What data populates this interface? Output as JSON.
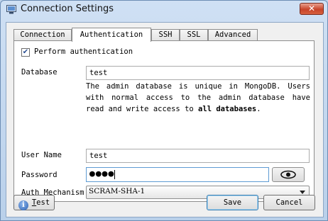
{
  "window": {
    "title": "Connection Settings",
    "close": "✕"
  },
  "tabs": [
    {
      "label": "Connection"
    },
    {
      "label": "Authentication"
    },
    {
      "label": "SSH"
    },
    {
      "label": "SSL"
    },
    {
      "label": "Advanced"
    }
  ],
  "active_tab": "Authentication",
  "auth": {
    "perform_label": "Perform authentication",
    "perform_checked": true,
    "database_label": "Database",
    "database_value": "test",
    "note_prefix": "The admin database is unique in MongoDB. Users with normal access to the admin database have read and write access to ",
    "note_bold": "all databases",
    "note_suffix": ".",
    "username_label": "User Name",
    "username_value": "test",
    "password_label": "Password",
    "password_masked": "●●●●",
    "mechanism_label": "Auth Mechanism",
    "mechanism_value": "SCRAM-SHA-1"
  },
  "buttons": {
    "test_prefix": "",
    "test_underline": "T",
    "test_rest": "est",
    "save": "Save",
    "cancel": "Cancel"
  },
  "icons": {
    "app": "window-icon",
    "info": "info-icon",
    "eye": "eye-icon",
    "check": "checkmark-icon"
  },
  "colors": {
    "title_bg": "#c5daf2",
    "close_red": "#c8442a",
    "accent_blue": "#3c7fb1"
  }
}
